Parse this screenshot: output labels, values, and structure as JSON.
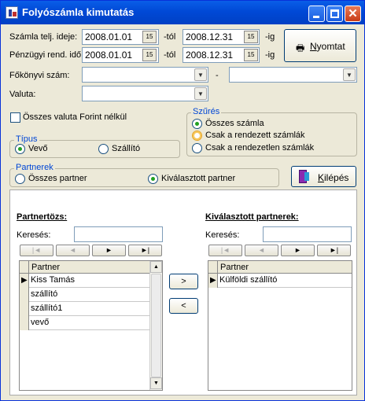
{
  "window": {
    "title": "Folyószámla kimutatás"
  },
  "filters": {
    "date_label": "Számla telj. ideje:",
    "fin_date_label": "Pénzügyi rend. idő:",
    "from_suffix": "-tól",
    "to_suffix": "-ig",
    "date_from": "2008.01.01",
    "date_to": "2008.12.31",
    "fin_date_from": "2008.01.01",
    "fin_date_to": "2008.12.31",
    "ledger_label": "Főkönyvi szám:",
    "ledger_dash": "-",
    "currency_label": "Valuta:",
    "all_currency_label": "Összes valuta Forint nélkül",
    "calendar_icon_text": "15"
  },
  "print_button": {
    "label": "Nyomtat"
  },
  "exit_button": {
    "label": "Kilépés"
  },
  "type_group": {
    "title": "Típus",
    "options": [
      "Vevő",
      "Szállító"
    ],
    "selected": "Vevő"
  },
  "filter_group": {
    "title": "Szűrés",
    "options": [
      "Összes számla",
      "Csak a rendezett számlák",
      "Csak a rendezetlen számlák"
    ],
    "selected": "Összes számla"
  },
  "partner_group": {
    "title": "Partnerek",
    "options": [
      "Összes partner",
      "Kiválasztott partner"
    ],
    "selected": "Kiválasztott partner"
  },
  "left_panel": {
    "title": "Partnertözs:",
    "search_label": "Keresés:",
    "search_value": "",
    "column": "Partner",
    "rows": [
      "Kiss Tamás",
      "szállító",
      "szállító1",
      "vevő"
    ]
  },
  "right_panel": {
    "title": "Kiválasztott partnerek:",
    "search_label": "Keresés:",
    "search_value": "",
    "column": "Partner",
    "rows": [
      "Külföldi szállító"
    ]
  },
  "transfer": {
    "add": ">",
    "remove": "<"
  },
  "nav_glyphs": {
    "first": "|◄",
    "prev": "◄",
    "next": "►",
    "last": "►|"
  }
}
